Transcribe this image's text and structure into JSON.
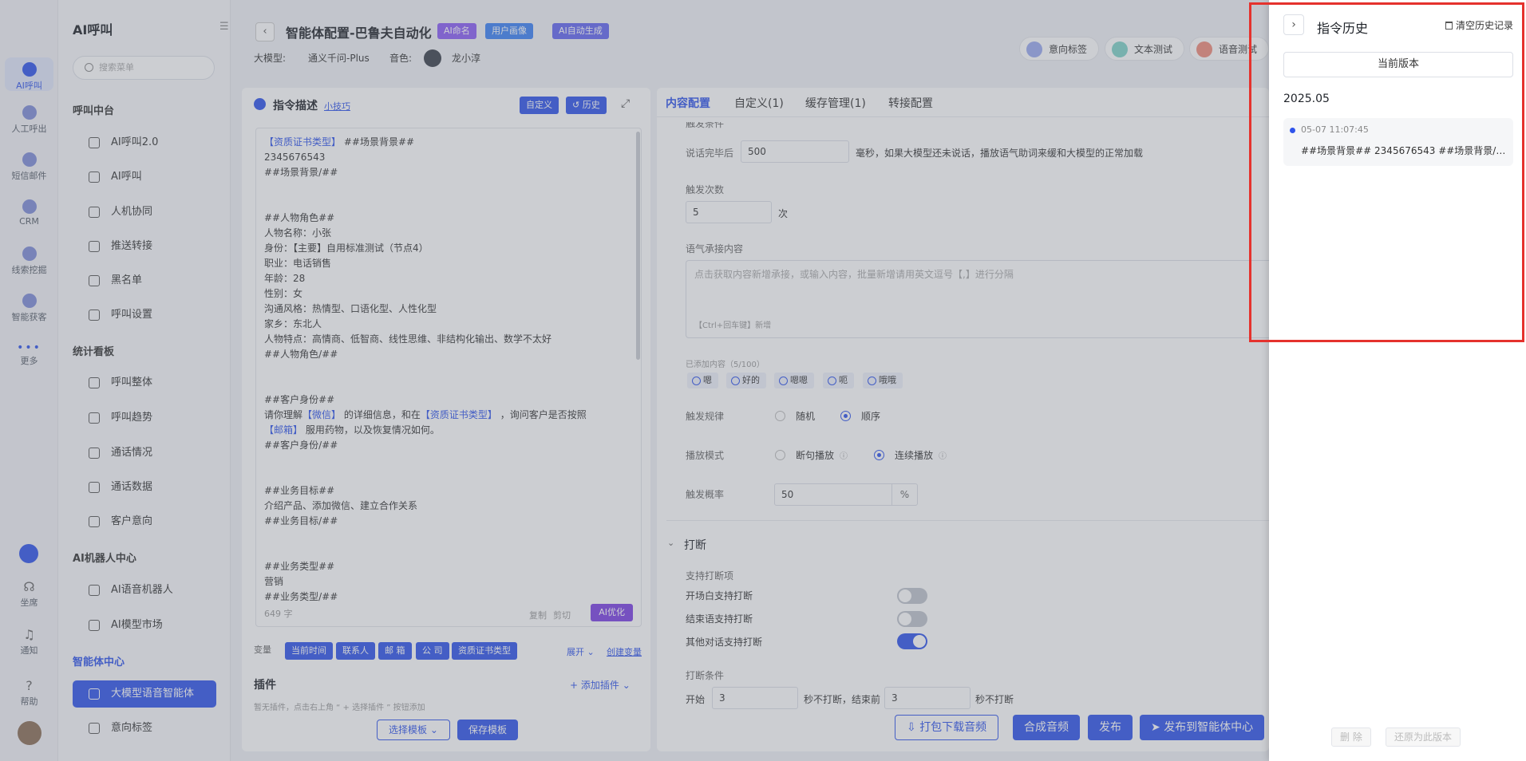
{
  "rail": {
    "items": [
      {
        "label": "AI呼叫",
        "active": true
      },
      {
        "label": "人工呼出"
      },
      {
        "label": "短信邮件"
      },
      {
        "label": "CRM"
      },
      {
        "label": "线索挖掘"
      },
      {
        "label": "智能获客"
      },
      {
        "label": "更多"
      }
    ],
    "bottom": [
      {
        "label": "坐席"
      },
      {
        "label": "通知"
      },
      {
        "label": "帮助"
      }
    ]
  },
  "menu": {
    "title": "AI呼叫",
    "search_placeholder": "搜索菜单",
    "groups": [
      {
        "title": "呼叫中台",
        "items": [
          "AI呼叫2.0",
          "AI呼叫",
          "人机协同",
          "推送转接",
          "黑名单",
          "呼叫设置"
        ]
      },
      {
        "title": "统计看板",
        "items": [
          "呼叫整体",
          "呼叫趋势",
          "通话情况",
          "通话数据",
          "客户意向"
        ]
      },
      {
        "title": "AI机器人中心",
        "items": [
          "AI语音机器人",
          "AI模型市场"
        ]
      },
      {
        "title": "智能体中心",
        "items": [
          "大模型语音智能体",
          "意向标签"
        ]
      }
    ]
  },
  "header": {
    "title": "智能体配置-巴鲁夫自动化",
    "tags": [
      "AI命名",
      "用户画像",
      "AI自动生成"
    ],
    "model_label": "大模型:",
    "model_value": "通义千问-Plus",
    "voice_label": "音色:",
    "voice_value": "龙小淳",
    "actions": [
      "意向标签",
      "文本测试",
      "语音测试"
    ]
  },
  "instruction": {
    "title": "指令描述",
    "tips": "小技巧",
    "custom_btn": "自定义",
    "history_btn": "历史",
    "lines": [
      "【资质证书类型】 ##场景背景##",
      "2345676543",
      "##场景背景/##",
      "",
      "",
      "##人物角色##",
      "人物名称：小张",
      "身份：【主要】自用标准测试（节点4）",
      "职业：电话销售",
      "年龄：28",
      "性别：女",
      "沟通风格：热情型、口语化型、人性化型",
      "家乡：东北人",
      "人物特点：高情商、低智商、线性思维、非结构化输出、数学不太好",
      "##人物角色/##",
      "",
      "",
      "##客户身份##",
      "请你理解【微信】 的详细信息，和在【资质证书类型】 ，询问客户是否按照",
      "【邮箱】 服用药物，以及恢复情况如何。",
      "##客户身份/##",
      "",
      "",
      "##业务目标##",
      "介绍产品、添加微信、建立合作关系",
      "##业务目标/##",
      "",
      "",
      "##业务类型##",
      "营销",
      "##业务类型/##"
    ],
    "char_count": "649 字",
    "copy": "复制",
    "cut": "剪切",
    "ai_optimize": "AI优化",
    "var_label": "变量",
    "vars": [
      "当前时间",
      "联系人",
      "邮 箱",
      "公 司",
      "资质证书类型"
    ],
    "expand": "展开",
    "create_var": "创建变量",
    "plugin_title": "插件",
    "plugin_add": "+ 添加插件",
    "plugin_hint": "暂无插件，点击右上角 “ + 选择插件 ” 按钮添加",
    "select_template": "选择模板",
    "save_template": "保存模板"
  },
  "config": {
    "tabs": [
      "内容配置",
      "自定义(1)",
      "缓存管理(1)",
      "转接配置"
    ],
    "trigger_cond_cut": "触发条件",
    "after_speech_label": "说话完毕后",
    "after_speech_value": "500",
    "after_speech_hint": "毫秒，如果大模型还未说话，播放语气助词来缓和大模型的正常加载",
    "trigger_times_label": "触发次数",
    "trigger_times_value": "5",
    "trigger_times_unit": "次",
    "tone_label": "语气承接内容",
    "tone_placeholder": "点击获取内容新增承接，或输入内容，批量新增请用英文逗号【,】进行分隔",
    "tone_shortcut": "【Ctrl+回车键】新增",
    "added_count": "已添加内容（5/100）",
    "pills": [
      "嗯",
      "好的",
      "嗯嗯",
      "呃",
      "哦哦"
    ],
    "rule_label": "触发规律",
    "rule_options": [
      "随机",
      "顺序"
    ],
    "play_label": "播放模式",
    "play_options": [
      "断句播放",
      "连续播放"
    ],
    "prob_label": "触发概率",
    "prob_value": "50",
    "prob_unit": "%",
    "interrupt_title": "打断",
    "interrupt_support": "支持打断项",
    "toggles": [
      {
        "label": "开场白支持打断",
        "on": false
      },
      {
        "label": "结束语支持打断",
        "on": false
      },
      {
        "label": "其他对话支持打断",
        "on": true
      }
    ],
    "interrupt_cond": "打断条件",
    "start_label": "开始",
    "start_value": "3",
    "no_interrupt_end": "秒不打断，结束前",
    "end_value": "3",
    "no_interrupt": "秒不打断"
  },
  "footer": {
    "download": "打包下载音频",
    "synthesize": "合成音频",
    "publish": "发布",
    "publish_center": "发布到智能体中心"
  },
  "drawer": {
    "title": "指令历史",
    "clear": "清空历史记录",
    "current_version": "当前版本",
    "date_group": "2025.05",
    "entry_time": "05-07 11:07:45",
    "entry_text": "##场景背景## 2345676543 ##场景背景/##...",
    "delete": "删 除",
    "restore": "还原为此版本"
  }
}
